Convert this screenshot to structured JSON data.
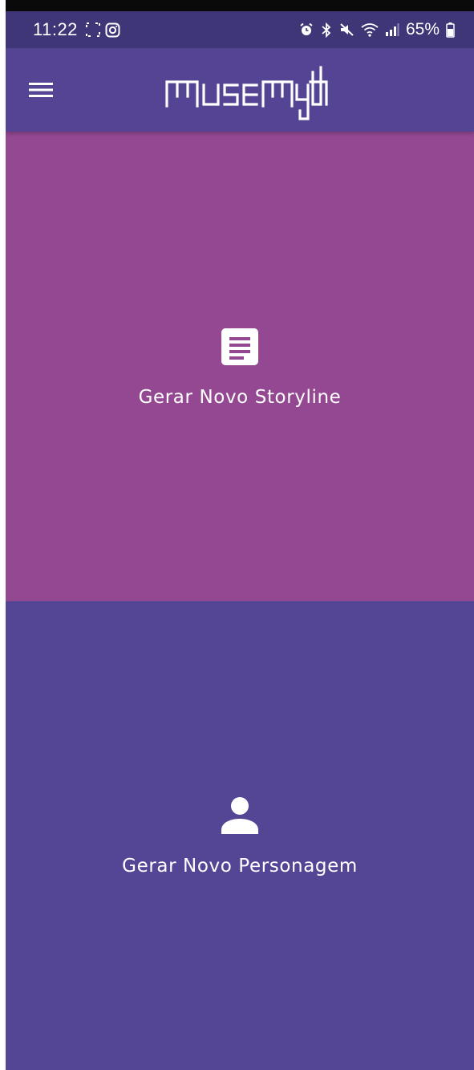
{
  "status_bar": {
    "time": "11:22",
    "battery": "65%",
    "left_icons": [
      "fullscreen-icon",
      "instagram-icon"
    ],
    "right_icons": [
      "alarm-icon",
      "bluetooth-icon",
      "mute-icon",
      "wifi-icon",
      "signal-icon",
      "battery-icon"
    ]
  },
  "app_bar": {
    "background": "#544493",
    "menu_icon": "hamburger-menu-icon",
    "logo_text": "musemyth"
  },
  "panels": [
    {
      "label": "Gerar Novo Storyline",
      "icon": "article-icon",
      "background": "#934891"
    },
    {
      "label": "Gerar Novo Personagem",
      "icon": "person-icon",
      "background": "#554595"
    }
  ]
}
